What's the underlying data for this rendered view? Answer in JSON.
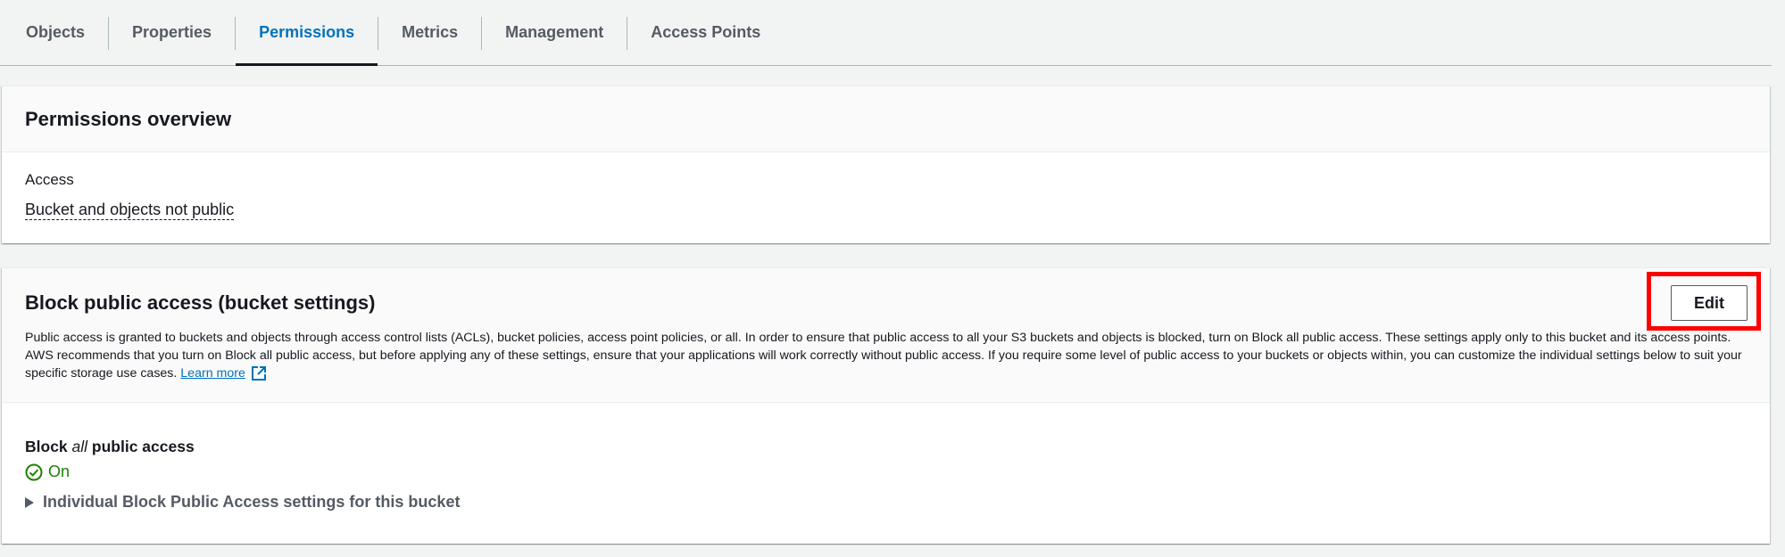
{
  "tabs": [
    {
      "label": "Objects",
      "active": false
    },
    {
      "label": "Properties",
      "active": false
    },
    {
      "label": "Permissions",
      "active": true
    },
    {
      "label": "Metrics",
      "active": false
    },
    {
      "label": "Management",
      "active": false
    },
    {
      "label": "Access Points",
      "active": false
    }
  ],
  "overview": {
    "title": "Permissions overview",
    "access_label": "Access",
    "access_value": "Bucket and objects not public"
  },
  "block_public_access": {
    "title": "Block public access (bucket settings)",
    "edit_label": "Edit",
    "description_line1": "Public access is granted to buckets and objects through access control lists (ACLs), bucket policies, access point policies, or all. In order to ensure that public access to all your S3 buckets and objects is blocked, turn on Block all public access. These settings apply only to this bucket",
    "description_line2": "and its access points. AWS recommends that you turn on Block all public access, but before applying any of these settings, ensure that your applications will work correctly without public access. If you require some level of public access to your buckets or objects within, you can",
    "description_line3": "customize the individual settings below to suit your specific storage use cases.",
    "learn_more": "Learn more",
    "block_all_prefix": "Block ",
    "block_all_em": "all",
    "block_all_suffix": " public access",
    "status": "On",
    "expander_label": "Individual Block Public Access settings for this bucket"
  },
  "colors": {
    "accent": "#0073bb",
    "success": "#1d8102",
    "highlight": "#ff0000"
  },
  "icons": {
    "status": "check-circle-icon",
    "external": "external-link-icon",
    "expander": "caret-right-icon"
  }
}
